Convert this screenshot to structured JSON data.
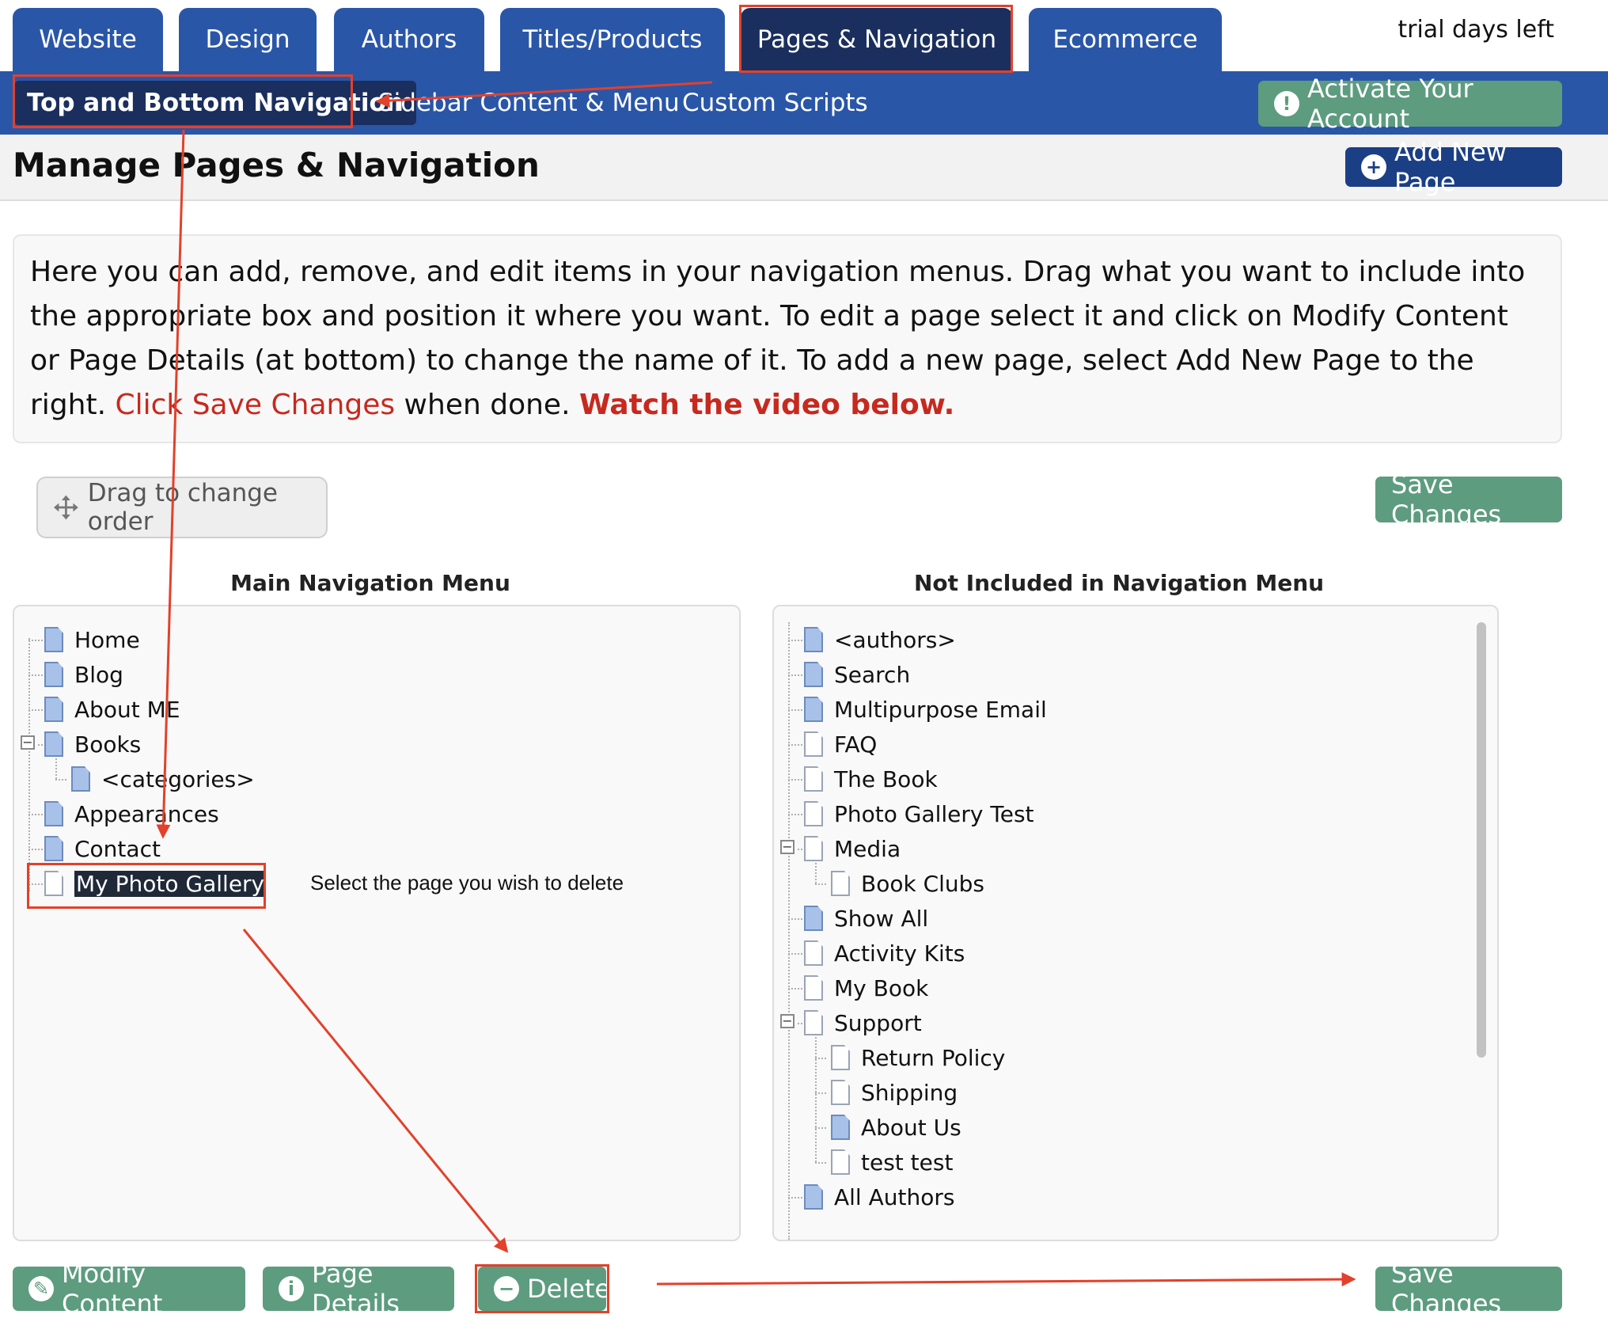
{
  "tabs": [
    {
      "label": "Website"
    },
    {
      "label": "Design"
    },
    {
      "label": "Authors"
    },
    {
      "label": "Titles/Products"
    },
    {
      "label": "Pages & Navigation"
    },
    {
      "label": "Ecommerce"
    }
  ],
  "trial_text": "trial days left",
  "subnav": [
    {
      "label": "Top and Bottom Navigation"
    },
    {
      "label": "Sidebar Content & Menu"
    },
    {
      "label": "Custom Scripts"
    }
  ],
  "activate_label": "Activate Your Account",
  "page_title": "Manage Pages & Navigation",
  "add_page_label": "Add New Page",
  "info": {
    "text1": "Here you can add, remove, and edit items in your navigation menus. Drag what you want to include into the appropriate box and position it where you want. To edit a page select it and click on Modify Content or Page Details (at bottom) to change the name of it. To add a new page, select Add New Page to the right. ",
    "save_hint": "Click Save Changes",
    "text2": " when done. ",
    "video": "Watch the video below."
  },
  "drag_label": "Drag to change order",
  "save_label": "Save Changes",
  "main_menu": {
    "title": "Main Navigation Menu",
    "items": [
      {
        "label": "Home"
      },
      {
        "label": "Blog"
      },
      {
        "label": "About ME"
      },
      {
        "label": "Books"
      },
      {
        "label": "<categories>"
      },
      {
        "label": "Appearances"
      },
      {
        "label": "Contact"
      },
      {
        "label": "My Photo Gallery"
      }
    ]
  },
  "not_included": {
    "title": "Not Included in Navigation Menu",
    "items": [
      {
        "label": "<authors>"
      },
      {
        "label": "Search"
      },
      {
        "label": "Multipurpose Email"
      },
      {
        "label": "FAQ"
      },
      {
        "label": "The Book"
      },
      {
        "label": "Photo Gallery Test"
      },
      {
        "label": "Media"
      },
      {
        "label": "Book Clubs"
      },
      {
        "label": "Show All"
      },
      {
        "label": "Activity Kits"
      },
      {
        "label": "My Book"
      },
      {
        "label": "Support"
      },
      {
        "label": "Return Policy"
      },
      {
        "label": "Shipping"
      },
      {
        "label": "About Us"
      },
      {
        "label": "test test"
      },
      {
        "label": "All Authors"
      }
    ]
  },
  "hint_text": "Select the page you wish to delete",
  "bottom": {
    "modify_label": "Modify Content",
    "details_label": "Page Details",
    "delete_label": "Delete",
    "save_label": "Save Changes"
  },
  "colors": {
    "tab_blue": "#2a56a8",
    "tab_active": "#1b2f5e",
    "green_button": "#5d9c7f",
    "annotation_red": "#e2412b",
    "text_red": "#c7291f"
  }
}
